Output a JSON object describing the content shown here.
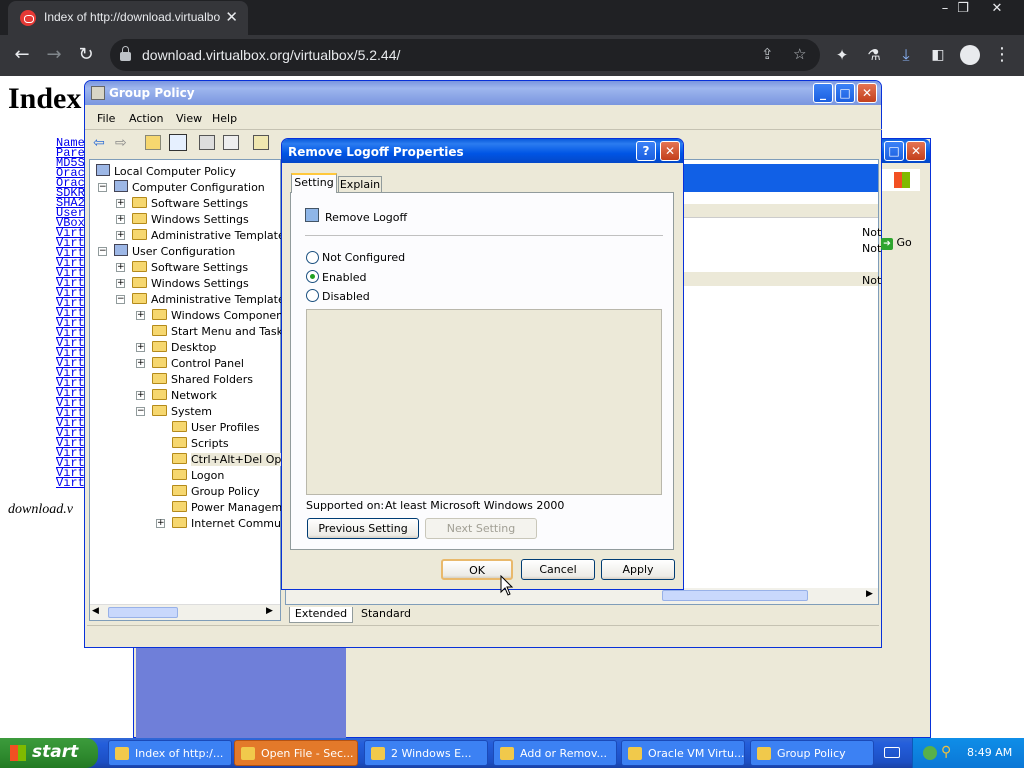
{
  "browser": {
    "tab_title": "Index of http://download.virtualbo",
    "url": "download.virtualbox.org/virtualbox/5.2.44/"
  },
  "page": {
    "heading": "Index",
    "links": [
      "Name",
      "Pare",
      "MD5S",
      "Orac",
      "Orac",
      "SDKR",
      "SHA2",
      "User",
      "VBox",
      "Virt",
      "Virt",
      "Virt",
      "Virt",
      "Virt",
      "Virt",
      "Virt",
      "Virt",
      "Virt",
      "Virt",
      "Virt",
      "Virt",
      "Virt",
      "Virt",
      "Virt",
      "Virt",
      "Virt",
      "Virt",
      "Virt",
      "Virt",
      "Virt",
      "Virt",
      "Virt",
      "Virt",
      "Virt",
      "Virt"
    ],
    "footer": "download.v"
  },
  "group_policy": {
    "title": "Group Policy",
    "menu": [
      "File",
      "Action",
      "View",
      "Help"
    ],
    "tree": [
      {
        "label": "Local Computer Policy",
        "level": 0,
        "expander": ""
      },
      {
        "label": "Computer Configuration",
        "level": 1,
        "expander": "-"
      },
      {
        "label": "Software Settings",
        "level": 2,
        "expander": "+"
      },
      {
        "label": "Windows Settings",
        "level": 2,
        "expander": "+"
      },
      {
        "label": "Administrative Templates",
        "level": 2,
        "expander": "+"
      },
      {
        "label": "User Configuration",
        "level": 1,
        "expander": "-"
      },
      {
        "label": "Software Settings",
        "level": 2,
        "expander": "+"
      },
      {
        "label": "Windows Settings",
        "level": 2,
        "expander": "+"
      },
      {
        "label": "Administrative Templates",
        "level": 2,
        "expander": "-"
      },
      {
        "label": "Windows Components",
        "level": 3,
        "expander": "+"
      },
      {
        "label": "Start Menu and Taskba",
        "level": 3,
        "expander": ""
      },
      {
        "label": "Desktop",
        "level": 3,
        "expander": "+"
      },
      {
        "label": "Control Panel",
        "level": 3,
        "expander": "+"
      },
      {
        "label": "Shared Folders",
        "level": 3,
        "expander": ""
      },
      {
        "label": "Network",
        "level": 3,
        "expander": "+"
      },
      {
        "label": "System",
        "level": 3,
        "expander": "-"
      },
      {
        "label": "User Profiles",
        "level": 4,
        "expander": ""
      },
      {
        "label": "Scripts",
        "level": 4,
        "expander": ""
      },
      {
        "label": "Ctrl+Alt+Del Optio",
        "level": 4,
        "expander": ""
      },
      {
        "label": "Logon",
        "level": 4,
        "expander": ""
      },
      {
        "label": "Group Policy",
        "level": 4,
        "expander": ""
      },
      {
        "label": "Power Managemen",
        "level": 4,
        "expander": ""
      },
      {
        "label": "Internet Communic",
        "level": 4,
        "expander": "+"
      }
    ],
    "right_values": [
      "Not",
      "Not",
      "Not"
    ],
    "tabs": [
      "Extended",
      "Standard"
    ],
    "go_label": "Go"
  },
  "dialog": {
    "title": "Remove Logoff Properties",
    "tabs": [
      "Setting",
      "Explain"
    ],
    "policy_name": "Remove Logoff",
    "options": [
      {
        "label": "Not Configured",
        "selected": false
      },
      {
        "label": "Enabled",
        "selected": true
      },
      {
        "label": "Disabled",
        "selected": false
      }
    ],
    "supported_label": "Supported on:",
    "supported_value": "At least Microsoft Windows 2000",
    "prev_button": "Previous Setting",
    "next_button": "Next Setting",
    "ok_button": "OK",
    "cancel_button": "Cancel",
    "apply_button": "Apply"
  },
  "taskbar": {
    "start_label": "start",
    "items": [
      {
        "label": "Index of http:/...",
        "active": false
      },
      {
        "label": "Open File - Sec...",
        "active": true
      },
      {
        "label": "2 Windows E...",
        "active": false
      },
      {
        "label": "Add or Remov...",
        "active": false
      },
      {
        "label": "Oracle VM Virtu...",
        "active": false
      },
      {
        "label": "Group Policy",
        "active": false
      }
    ],
    "clock": "8:49 AM"
  }
}
